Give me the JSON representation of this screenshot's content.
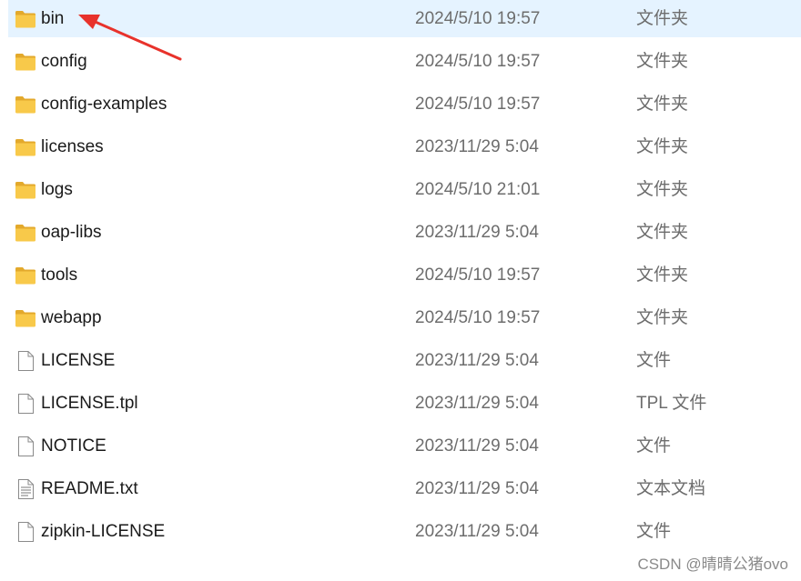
{
  "files": [
    {
      "name": "bin",
      "date": "2024/5/10 19:57",
      "type": "文件夹",
      "icon": "folder-icon",
      "selected": true
    },
    {
      "name": "config",
      "date": "2024/5/10 19:57",
      "type": "文件夹",
      "icon": "folder-icon",
      "selected": false
    },
    {
      "name": "config-examples",
      "date": "2024/5/10 19:57",
      "type": "文件夹",
      "icon": "folder-icon",
      "selected": false
    },
    {
      "name": "licenses",
      "date": "2023/11/29 5:04",
      "type": "文件夹",
      "icon": "folder-icon",
      "selected": false
    },
    {
      "name": "logs",
      "date": "2024/5/10 21:01",
      "type": "文件夹",
      "icon": "folder-icon",
      "selected": false
    },
    {
      "name": "oap-libs",
      "date": "2023/11/29 5:04",
      "type": "文件夹",
      "icon": "folder-icon",
      "selected": false
    },
    {
      "name": "tools",
      "date": "2024/5/10 19:57",
      "type": "文件夹",
      "icon": "folder-icon",
      "selected": false
    },
    {
      "name": "webapp",
      "date": "2024/5/10 19:57",
      "type": "文件夹",
      "icon": "folder-icon",
      "selected": false
    },
    {
      "name": "LICENSE",
      "date": "2023/11/29 5:04",
      "type": "文件",
      "icon": "file-icon",
      "selected": false
    },
    {
      "name": "LICENSE.tpl",
      "date": "2023/11/29 5:04",
      "type": "TPL 文件",
      "icon": "file-icon",
      "selected": false
    },
    {
      "name": "NOTICE",
      "date": "2023/11/29 5:04",
      "type": "文件",
      "icon": "file-icon",
      "selected": false
    },
    {
      "name": "README.txt",
      "date": "2023/11/29 5:04",
      "type": "文本文档",
      "icon": "text-file-icon",
      "selected": false
    },
    {
      "name": "zipkin-LICENSE",
      "date": "2023/11/29 5:04",
      "type": "文件",
      "icon": "file-icon",
      "selected": false
    }
  ],
  "colors": {
    "selection": "#e5f3ff",
    "folder": "#f8c94a",
    "folder_dark": "#e3a92c",
    "annotation_arrow": "#e8322b"
  },
  "watermark": "CSDN @晴晴公猪ovo"
}
